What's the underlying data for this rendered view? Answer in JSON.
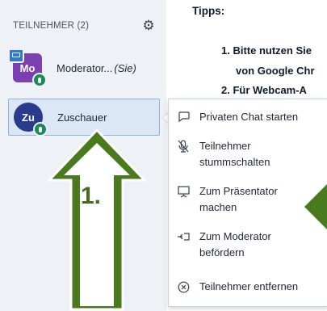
{
  "sidebar": {
    "header": "TEILNEHMER (2)",
    "users": [
      {
        "initials": "Mo",
        "name": "Moderator...",
        "suffix": "(Sie)"
      },
      {
        "initials": "Zu",
        "name": "Zuschauer",
        "suffix": ""
      }
    ]
  },
  "main": {
    "title": "Tipps:",
    "tips": [
      "1. Bitte nutzen Sie",
      "von Google Chr",
      "2. Für Webcam-A"
    ]
  },
  "context_menu": {
    "items": [
      {
        "icon": "chat-bubble-icon",
        "label": "Privaten Chat starten"
      },
      {
        "icon": "mic-off-icon",
        "label": "Teilnehmer\nstummschalten"
      },
      {
        "icon": "presentation-screen-icon",
        "label": "Zum Präsentator\nmachen"
      },
      {
        "icon": "promote-icon",
        "label": "Zum Moderator\nbefördern"
      },
      {
        "icon": "remove-circle-icon",
        "label": "Teilnehmer entfernen"
      }
    ]
  },
  "annotation": {
    "step": "1."
  },
  "colors": {
    "arrow": "#4a7a1e",
    "arrow_stroke": "#ffffff",
    "selected_bg": "#dbe7f5"
  }
}
